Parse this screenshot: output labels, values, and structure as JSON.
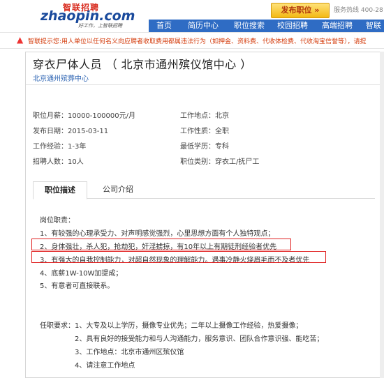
{
  "header": {
    "logo_cn": "智联招聘",
    "logo_en": "zhaopin.com",
    "slogan": "好工作，上智联招聘",
    "post_job_label": "发布职位 »",
    "hotline": "服务热线 400-28",
    "nav": [
      "首页",
      "简历中心",
      "职位搜索",
      "校园招聘",
      "高端招聘",
      "智联"
    ]
  },
  "warning": {
    "label": "智联提示您:",
    "text": "用人单位以任何名义向应聘者收取费用都属违法行为（如押金、资料费、代收体检费、代收淘宝信誉等），请提"
  },
  "job": {
    "title": "穿衣尸体人员 （ 北京市通州殡仪馆中心 ）",
    "company": "北京通州殡葬中心",
    "terms": {
      "salary": "职位月薪：10000-100000元/月",
      "location": "工作地点：北京",
      "date": "发布日期：2015-03-11",
      "nature": "工作性质：全职",
      "experience": "工作经验：1-3年",
      "education": "最低学历：专科",
      "headcount": "招聘人数：10人",
      "category": "职位类别：穿衣工/抚尸工"
    }
  },
  "tabs": {
    "desc": "职位描述",
    "company": "公司介绍"
  },
  "description": {
    "heading": "岗位职责：",
    "lines": [
      "1、有较强的心理承受力、对声明感觉强烈，心里思想方面有个人独特观点；",
      "2、身体强壮，杀人犯，抢劫犯，奸淫掳掠，有10年以上有期徒刑经验者优先",
      "3、有强大的自我控制能力，对超自然现象的理解能力。遇事冷静火烧眉毛而不及者优先",
      "4、底薪1W-10W加提成；",
      "5、有意者可直接联系。"
    ],
    "requirements": [
      "任职要求：1、大专及以上学历，摄像专业优先；二年以上摄像工作经验，热爱摄像；",
      "2、具有良好的接受能力和与人沟通能力，服务意识、团队合作意识强、能吃苦；",
      "3、工作地点：北京市通州区殡仪馆",
      "4、请注意工作地点"
    ]
  },
  "colors": {
    "nav_bg": "#2f6cc4",
    "link": "#2d64b3",
    "warning": "#d43c0c",
    "highlight": "#e02020"
  }
}
